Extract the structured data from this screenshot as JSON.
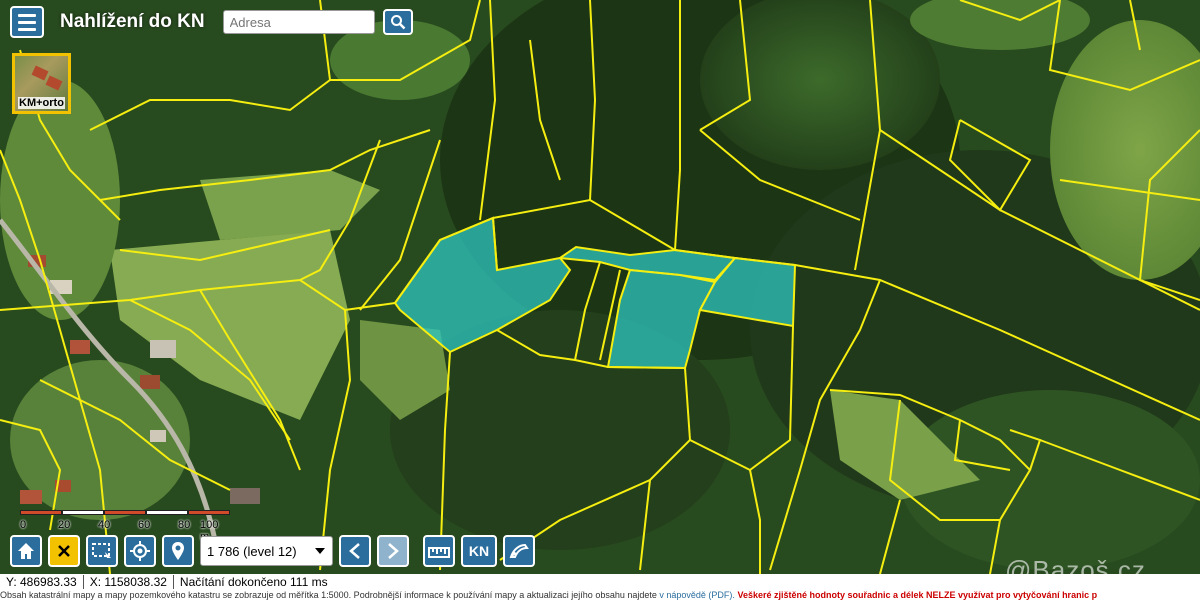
{
  "header": {
    "app_title": "Nahlížení do KN",
    "search_placeholder": "Adresa",
    "menu_icon": "hamburger-icon",
    "search_icon": "search-icon"
  },
  "layer_switcher": {
    "label": "KM+orto"
  },
  "scale_bar": {
    "labels": [
      "0",
      "20",
      "40",
      "60",
      "80",
      "100 m"
    ]
  },
  "toolbar": {
    "zoom_level_select": "1 786 (level 12)",
    "kn_label": "KN",
    "buttons": [
      "home-icon",
      "close-icon",
      "select-area-icon",
      "gps-locate-icon",
      "map-pin-icon",
      "chevron-left-icon",
      "chevron-right-icon",
      "measure-icon",
      "kn-layer-icon",
      "draw-icon"
    ]
  },
  "status": {
    "y_coord": "Y: 486983.33",
    "x_coord": "X: 1158038.32",
    "load_message": "Načítání dokončeno 111 ms"
  },
  "info_bar": {
    "text": "Obsah katastrální mapy a mapy pozemkového katastru se zobrazuje od měřítka 1:5000. Podrobnější informace k používání mapy a aktualizaci jejího obsahu najdete",
    "link": "v nápovědě (PDF).",
    "warning": "Veškeré zjištěné hodnoty souřadnic a délek NELZE využívat pro vytyčování hranic p"
  },
  "watermark": "@Bazoš.cz",
  "colors": {
    "accent_blue": "#2b6e9e",
    "parcel_line": "#f5ee10",
    "selected_parcel_fill": "#2ec7c0",
    "active_button": "#f2c200"
  }
}
